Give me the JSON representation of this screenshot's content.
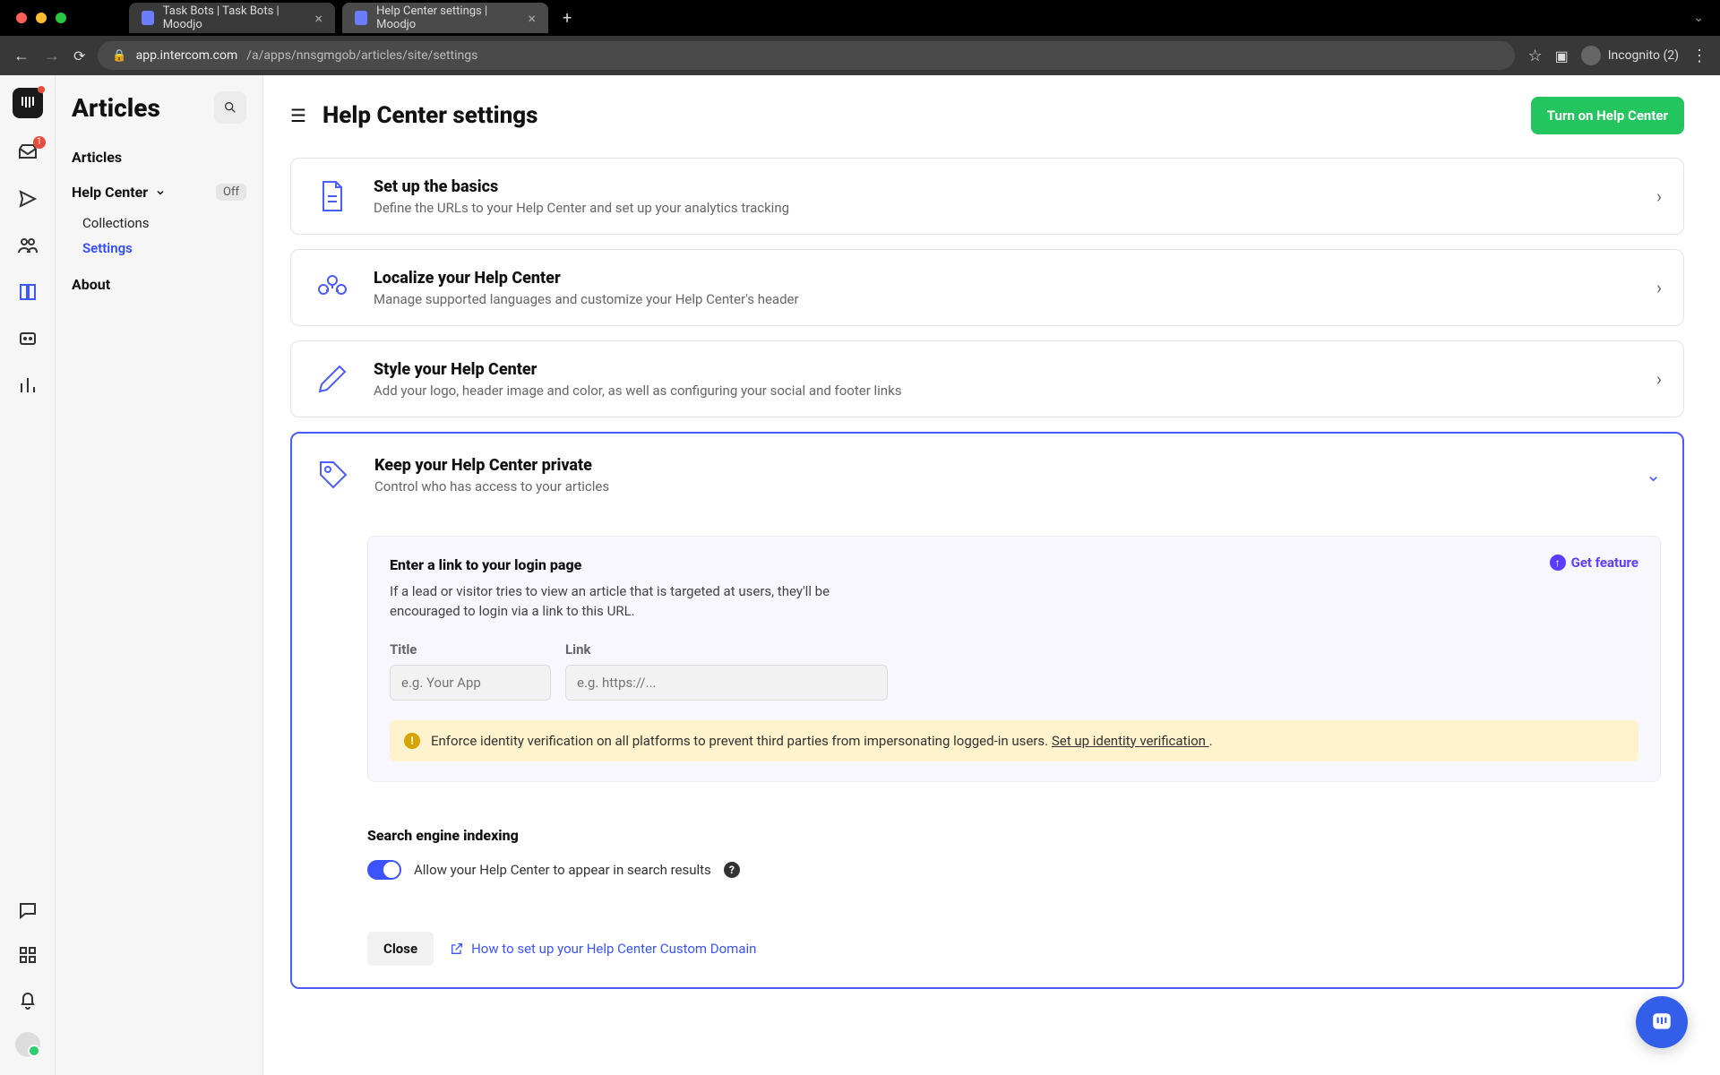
{
  "os": {
    "tabs": [
      {
        "title": "Task Bots | Task Bots | Moodjo"
      },
      {
        "title": "Help Center settings | Moodjo"
      }
    ],
    "chevron": "⌄"
  },
  "url": {
    "host": "app.intercom.com",
    "path": "/a/apps/nnsgmgob/articles/site/settings",
    "incognito_label": "Incognito (2)"
  },
  "rail": {
    "inbox_badge": "1"
  },
  "sidebar": {
    "title": "Articles",
    "items": {
      "articles": "Articles",
      "help_center": "Help Center",
      "off_label": "Off",
      "collections": "Collections",
      "settings": "Settings",
      "about": "About"
    }
  },
  "header": {
    "page_title": "Help Center settings",
    "cta": "Turn on Help Center"
  },
  "cards": [
    {
      "title": "Set up the basics",
      "desc": "Define the URLs to your Help Center and set up your analytics tracking"
    },
    {
      "title": "Localize your Help Center",
      "desc": "Manage supported languages and customize your Help Center's header"
    },
    {
      "title": "Style your Help Center",
      "desc": "Add your logo, header image and color, as well as configuring your social and footer links"
    },
    {
      "title": "Keep your Help Center private",
      "desc": "Control who has access to your articles"
    }
  ],
  "private_panel": {
    "title": "Enter a link to your login page",
    "desc": "If a lead or visitor tries to view an article that is targeted at users, they'll be encouraged to login via a link to this URL.",
    "get_feature": "Get feature",
    "title_label": "Title",
    "link_label": "Link",
    "title_placeholder": "e.g. Your App",
    "link_placeholder": "e.g. https://...",
    "alert_text": "Enforce identity verification on all platforms to prevent third parties from impersonating logged-in users. ",
    "alert_link": "Set up identity verification ",
    "alert_period": "."
  },
  "indexing": {
    "section_title": "Search engine indexing",
    "toggle_label": "Allow your Help Center to appear in search results"
  },
  "footer": {
    "close": "Close",
    "how_link": "How to set up your Help Center Custom Domain"
  }
}
